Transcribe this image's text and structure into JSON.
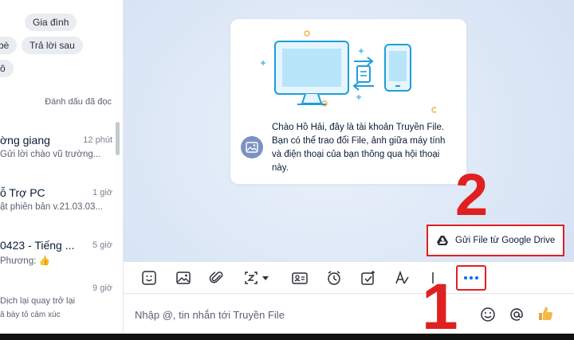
{
  "sidebar": {
    "tags": [
      "Gia đình",
      "bè",
      "Trả lời sau",
      "ô"
    ],
    "mark_read": "Đánh dấu đã đọc",
    "conversations": [
      {
        "name": "ờng giang",
        "time": "12 phút",
        "snippet": "Gửi lời chào vũ trường..."
      },
      {
        "name": "ỗ Trợ PC",
        "time": "1 giờ",
        "snippet": "ật phiên bản v.21.03.03..."
      },
      {
        "name": "0423 - Tiếng ...",
        "time": "5 giờ",
        "snippet": "Phương: 👍"
      },
      {
        "name": "",
        "time": "9 giờ",
        "snippet": "Dịch lại quay trở lại"
      },
      {
        "name": "",
        "time": "",
        "snippet": "ã bày tỏ cảm xúc"
      }
    ]
  },
  "chat": {
    "welcome_text": "Chào Hồ Hải, đây là tài khoản Truyền File. Bạn có thể trao đổi File, ảnh giữa máy tính và điện thoại của bạn thông qua hội thoại này.",
    "drive_button": "Gửi File từ Google Drive",
    "input_placeholder": "Nhập @, tin nhắn tới Truyền File",
    "toolbar_icons": [
      "sticker-icon",
      "image-icon",
      "attach-icon",
      "screenshot-icon",
      "contact-card-icon",
      "reminder-clock-icon",
      "task-icon",
      "text-format-icon",
      "more-icon"
    ]
  },
  "annotations": {
    "step_1": "1",
    "step_2": "2"
  },
  "colors": {
    "accent": "#0068ff",
    "annotation": "#e02020",
    "chat_bg": "#dce7f6"
  }
}
